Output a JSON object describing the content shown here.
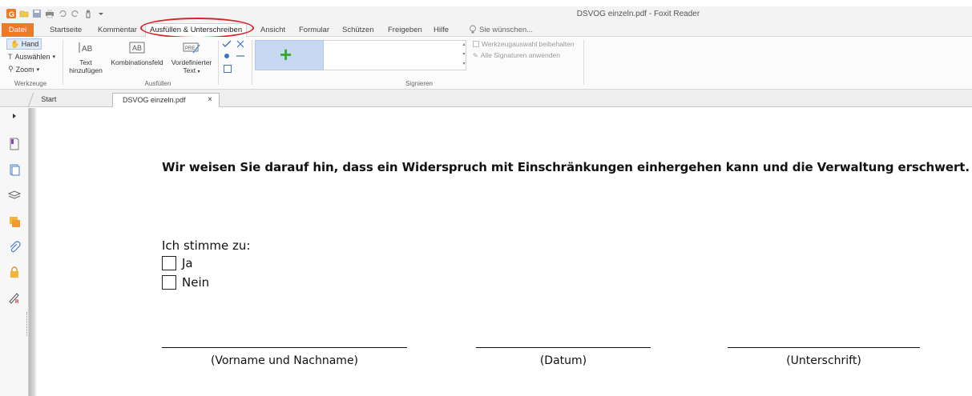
{
  "window": {
    "title": "DSVOG einzeln.pdf - Foxit Reader"
  },
  "ribbon_tabs": [
    {
      "label": "Datei"
    },
    {
      "label": "Startseite"
    },
    {
      "label": "Kommentar"
    },
    {
      "label": "Ausfüllen & Unterschreiben"
    },
    {
      "label": "Ansicht"
    },
    {
      "label": "Formular"
    },
    {
      "label": "Schützen"
    },
    {
      "label": "Freigeben"
    },
    {
      "label": "Hilfe"
    }
  ],
  "search": {
    "placeholder": "Sie wünschen..."
  },
  "tools_group": {
    "hand": "Hand",
    "select": "Auswählen",
    "zoom": "Zoom",
    "label": "Werkzeuge"
  },
  "fill_group": {
    "add_text": "Text hinzufügen",
    "combo": "Kombinationsfeld",
    "predefined": "Vordefinierter Text",
    "label": "Ausfüllen"
  },
  "sign_group": {
    "keep_tool": "Werkzeugauswahl beibehalten",
    "apply_all": "Alle Signaturen anwenden",
    "label": "Signieren"
  },
  "doc_tabs": [
    {
      "label": "Start"
    },
    {
      "label": "DSVOG einzeln.pdf"
    }
  ],
  "document": {
    "headline": "Wir weisen Sie darauf hin, dass ein Widerspruch mit Einschränkungen einhergehen kann und die Verwaltung erschwert.",
    "agree_label": "Ich stimme zu:",
    "option_yes": "Ja",
    "option_no": "Nein",
    "sig_name": "(Vorname und Nachname)",
    "sig_date": "(Datum)",
    "sig_signature": "(Unterschrift)"
  },
  "colors": {
    "accent": "#e87c2a",
    "highlight_ring": "#d6262a",
    "plus": "#39a835"
  }
}
